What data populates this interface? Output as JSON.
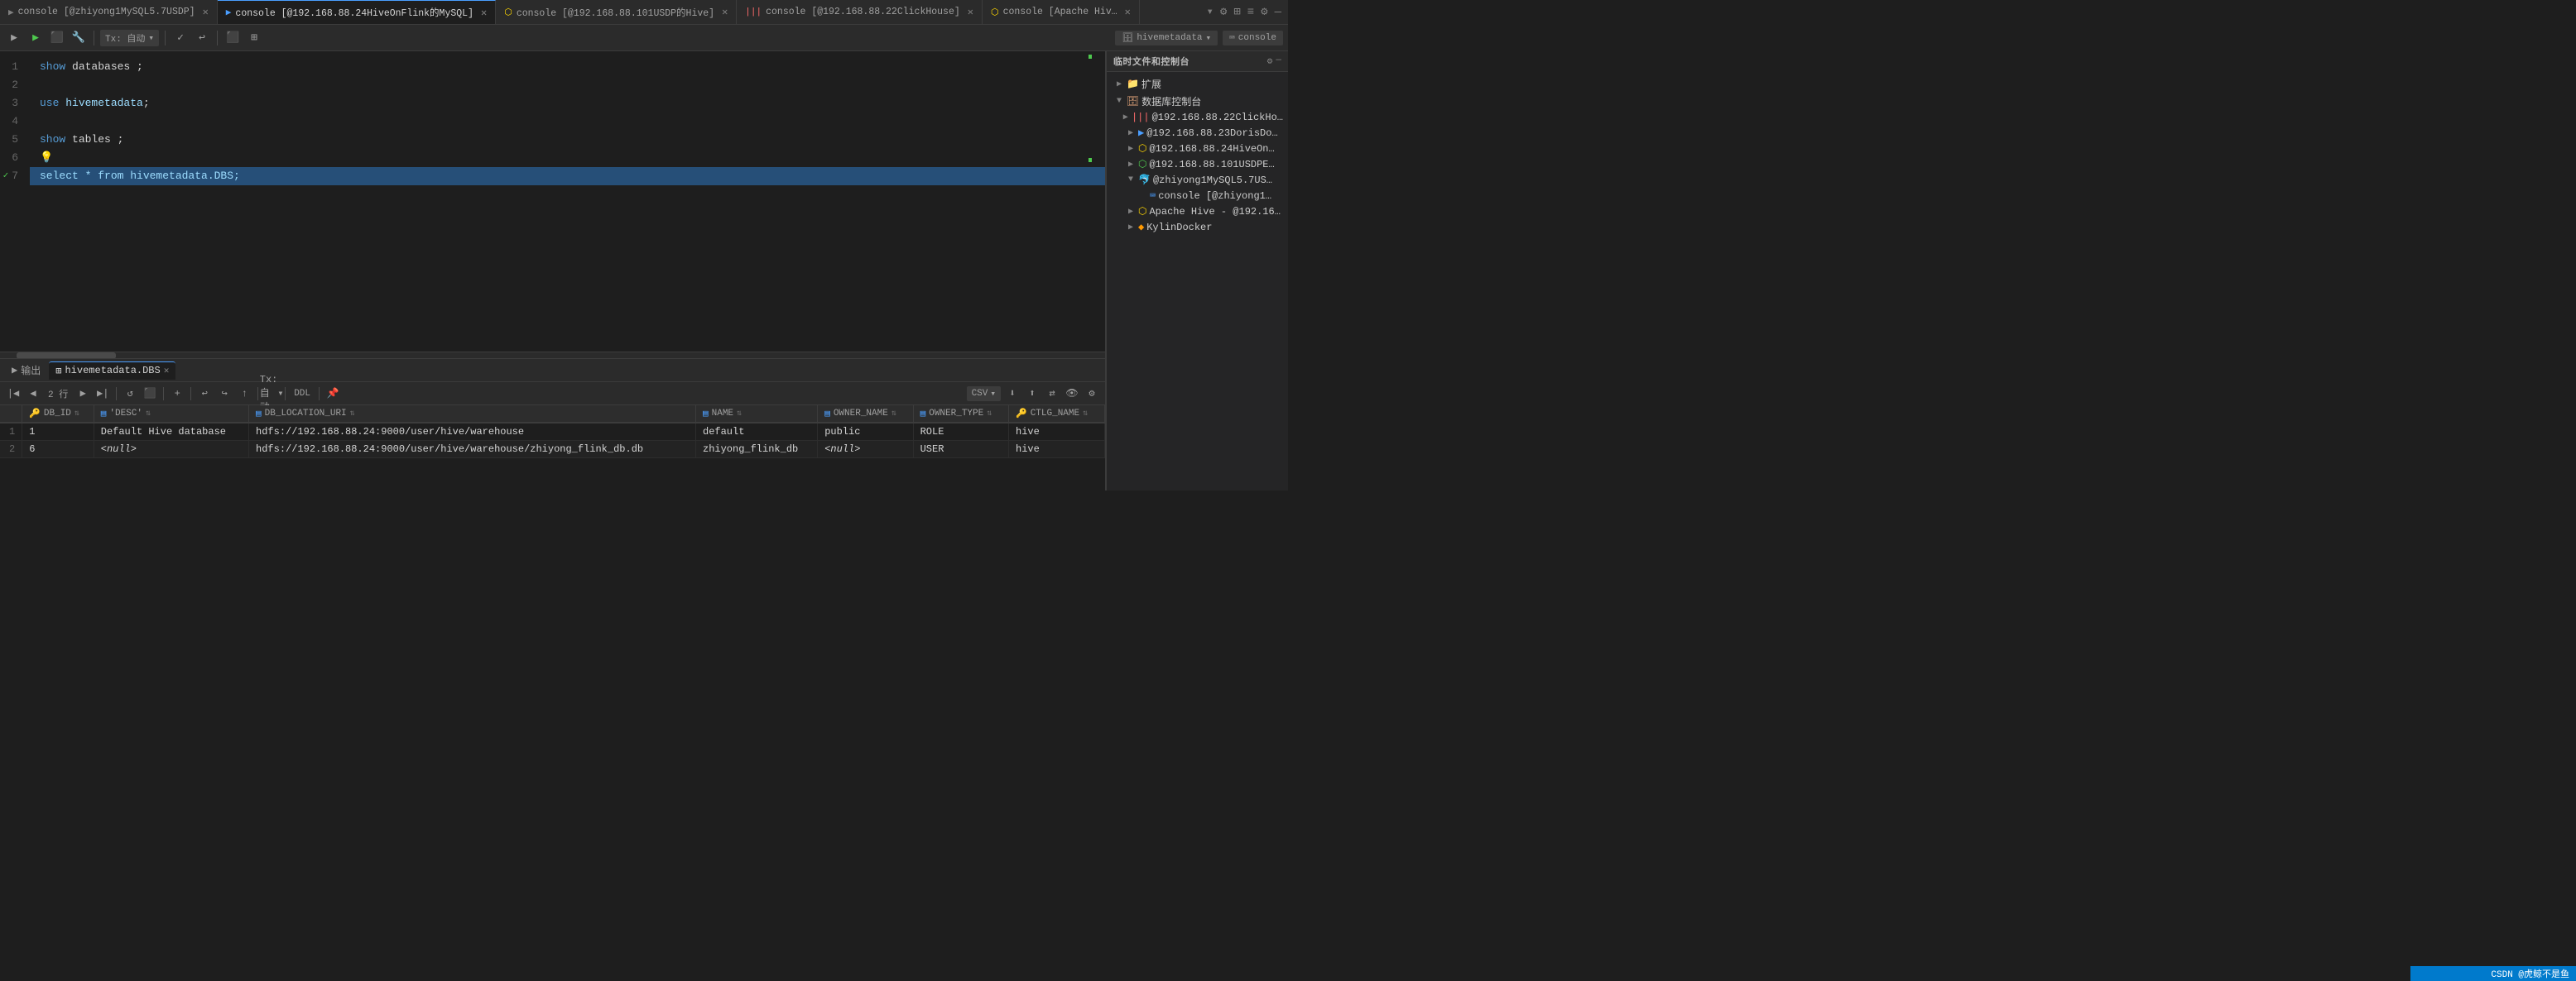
{
  "tabs": [
    {
      "id": "tab1",
      "label": "console [@zhiyong1MySQL5.7USDP]",
      "active": false,
      "icon": "▶",
      "iconColor": "#808080"
    },
    {
      "id": "tab2",
      "label": "console [@192.168.88.24HiveOnFlink的MySQL]",
      "active": true,
      "icon": "▶",
      "iconColor": "#4a9eff"
    },
    {
      "id": "tab3",
      "label": "console [@192.168.88.101USDP的Hive]",
      "active": false,
      "icon": "▶",
      "iconColor": "#ffd700"
    },
    {
      "id": "tab4",
      "label": "console [@192.168.88.22ClickHouse]",
      "active": false,
      "icon": "|||",
      "iconColor": "#ff6b6b"
    },
    {
      "id": "tab5",
      "label": "console [Apache Hiv…",
      "active": false,
      "icon": "▶",
      "iconColor": "#ffd700"
    }
  ],
  "toolbar": {
    "tx_label": "Tx: 自动",
    "conn_label": "hivemetadata",
    "console_label": "console"
  },
  "editor": {
    "lines": [
      {
        "num": "1",
        "content": "show databases ;",
        "tokens": [
          {
            "text": "show",
            "cls": "kw"
          },
          {
            "text": " databases ",
            "cls": ""
          },
          {
            "text": ";",
            "cls": "op"
          }
        ]
      },
      {
        "num": "2",
        "content": "",
        "tokens": []
      },
      {
        "num": "3",
        "content": "use hivemetadata;",
        "tokens": [
          {
            "text": "use",
            "cls": "kw"
          },
          {
            "text": " ",
            "cls": ""
          },
          {
            "text": "hivemetadata",
            "cls": "ident"
          },
          {
            "text": ";",
            "cls": "op"
          }
        ]
      },
      {
        "num": "4",
        "content": "",
        "tokens": []
      },
      {
        "num": "5",
        "content": "show tables ;",
        "tokens": [
          {
            "text": "show",
            "cls": "kw"
          },
          {
            "text": " tables ",
            "cls": ""
          },
          {
            "text": ";",
            "cls": "op"
          }
        ]
      },
      {
        "num": "6",
        "content": "💡",
        "tokens": [
          {
            "text": "💡",
            "cls": ""
          }
        ]
      },
      {
        "num": "7",
        "content": "select * from hivemetadata.DBS;",
        "tokens": [
          {
            "text": "select",
            "cls": "selected-text"
          },
          {
            "text": " * from ",
            "cls": "selected-text"
          },
          {
            "text": "hivemetadata.DBS",
            "cls": "selected-text"
          },
          {
            "text": ";",
            "cls": "selected-text"
          }
        ],
        "selected": true,
        "hasCheck": true
      }
    ]
  },
  "sidebar": {
    "title": "数据库控制台",
    "header_title": "临时文件和控制台",
    "items": [
      {
        "label": "扩展",
        "indent": 1,
        "icon": "folder",
        "arrow": "▶",
        "type": "folder"
      },
      {
        "label": "数据库控制台",
        "indent": 0,
        "icon": "db",
        "arrow": "▼",
        "type": "folder",
        "open": true
      },
      {
        "label": "@192.168.88.22ClickHo…",
        "indent": 1,
        "icon": "clickhouse",
        "arrow": "▶",
        "type": "db"
      },
      {
        "label": "@192.168.88.23DorisDo…",
        "indent": 1,
        "icon": "doris",
        "arrow": "▶",
        "type": "db"
      },
      {
        "label": "@192.168.88.24HiveOn…",
        "indent": 1,
        "icon": "hive",
        "arrow": "▶",
        "type": "db"
      },
      {
        "label": "@192.168.88.101USDPE…",
        "indent": 1,
        "icon": "hive2",
        "arrow": "▶",
        "type": "db"
      },
      {
        "label": "@zhiyong1MySQL5.7US…",
        "indent": 1,
        "icon": "mysql",
        "arrow": "▶",
        "type": "db",
        "open": true
      },
      {
        "label": "console [@zhiyong1…",
        "indent": 2,
        "icon": "console",
        "arrow": "",
        "type": "console"
      },
      {
        "label": "Apache Hive - @192.16…",
        "indent": 1,
        "icon": "hive3",
        "arrow": "▶",
        "type": "db"
      },
      {
        "label": "KylinDocker",
        "indent": 1,
        "icon": "kylin",
        "arrow": "▶",
        "type": "db"
      }
    ]
  },
  "results": {
    "tabs": [
      {
        "label": "输出",
        "active": false,
        "icon": "▶"
      },
      {
        "label": "hivemetadata.DBS",
        "active": true,
        "icon": "grid"
      }
    ],
    "toolbar": {
      "page_info": "2 行",
      "tx_label": "Tx: 自动",
      "ddl_label": "DDL",
      "csv_label": "CSV"
    },
    "columns": [
      {
        "label": "DB_ID",
        "icon": "key"
      },
      {
        "label": "'DESC'",
        "icon": "col"
      },
      {
        "label": "DB_LOCATION_URI",
        "icon": "col"
      },
      {
        "label": "NAME",
        "icon": "col"
      },
      {
        "label": "OWNER_NAME",
        "icon": "col"
      },
      {
        "label": "OWNER_TYPE",
        "icon": "col"
      },
      {
        "label": "CTLG_NAME",
        "icon": "col"
      }
    ],
    "rows": [
      {
        "num": "1",
        "DB_ID": "1",
        "DESC": "Default Hive database",
        "DB_LOCATION_URI": "hdfs://192.168.88.24:9000/user/hive/warehouse",
        "NAME": "default",
        "OWNER_NAME": "public",
        "OWNER_TYPE": "ROLE",
        "CTLG_NAME": "hive"
      },
      {
        "num": "2",
        "DB_ID": "6",
        "DESC": "<null>",
        "DB_LOCATION_URI": "hdfs://192.168.88.24:9000/user/hive/warehouse/zhiyong_flink_db.db",
        "NAME": "zhiyong_flink_db",
        "OWNER_NAME": "<null>",
        "OWNER_TYPE": "USER",
        "CTLG_NAME": "hive"
      }
    ]
  },
  "status": {
    "text": "CSDN @虎鲸不是鱼"
  }
}
